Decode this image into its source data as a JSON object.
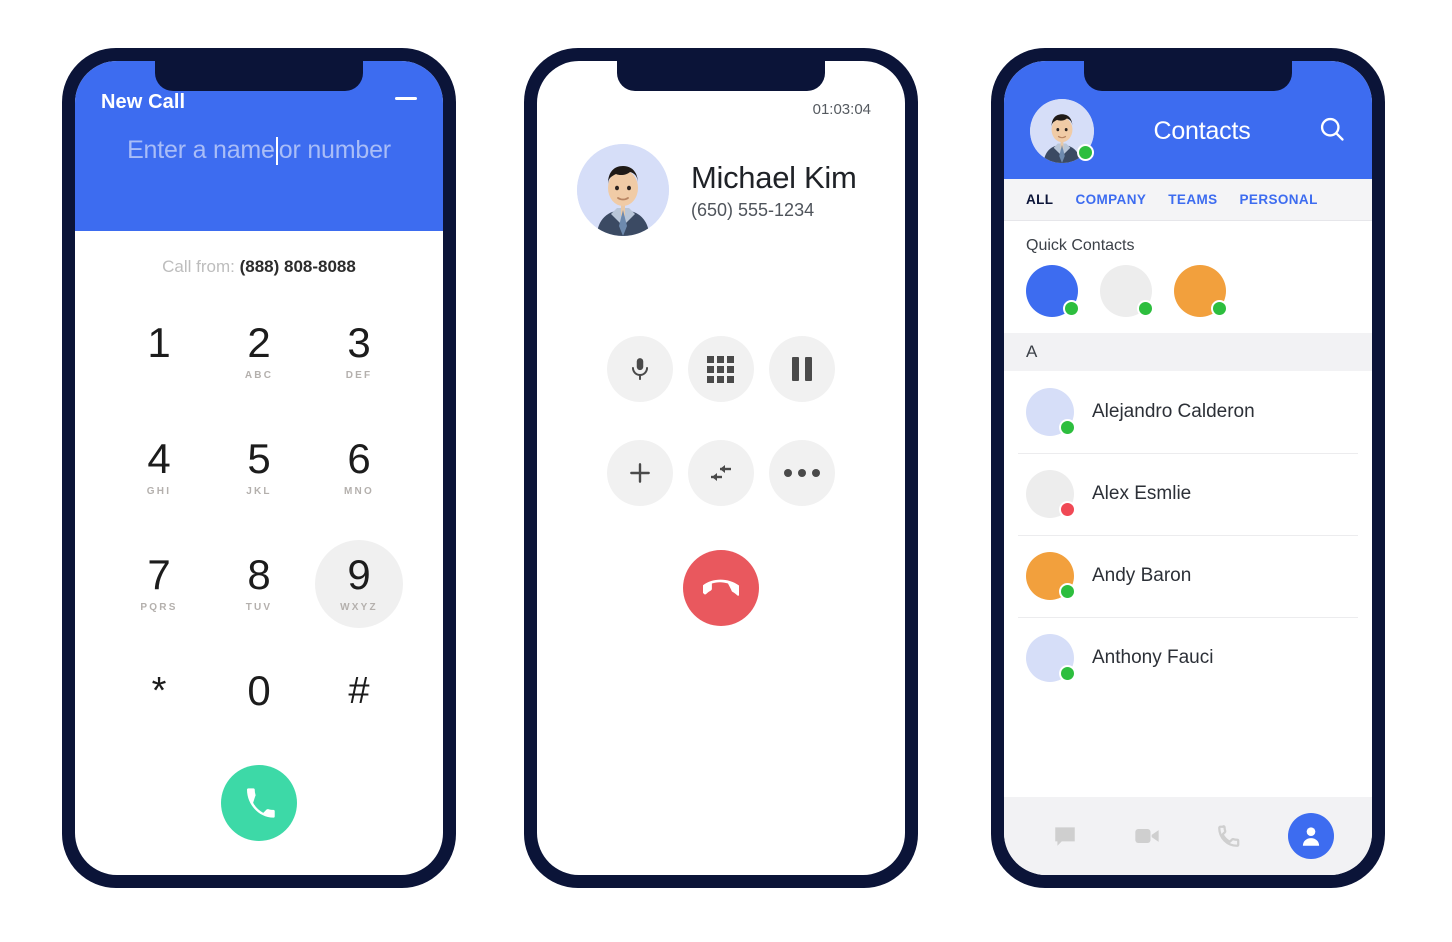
{
  "dialer": {
    "title": "New Call",
    "minimize_icon": "minimize-icon",
    "input_value_before_caret": "Enter a name",
    "input_value_after_caret": "or number",
    "input_placeholder": "Enter a name or number",
    "call_from_label": "Call from:",
    "call_from_number": "(888) 808-8088",
    "keys": [
      {
        "digit": "1",
        "letters": ""
      },
      {
        "digit": "2",
        "letters": "ABC"
      },
      {
        "digit": "3",
        "letters": "DEF"
      },
      {
        "digit": "4",
        "letters": "GHI"
      },
      {
        "digit": "5",
        "letters": "JKL"
      },
      {
        "digit": "6",
        "letters": "MNO"
      },
      {
        "digit": "7",
        "letters": "PQRS"
      },
      {
        "digit": "8",
        "letters": "TUV"
      },
      {
        "digit": "9",
        "letters": "WXYZ",
        "pressed": true
      },
      {
        "digit": "*",
        "letters": ""
      },
      {
        "digit": "0",
        "letters": ""
      },
      {
        "digit": "#",
        "letters": ""
      }
    ],
    "call_button_icon": "phone-icon",
    "colors": {
      "header": "#3D6CF0",
      "call_button": "#3DD9A7",
      "placeholder": "#A9BDF7"
    }
  },
  "active_call": {
    "timer": "01:03:04",
    "caller_name": "Michael Kim",
    "caller_number": "(650) 555-1234",
    "avatar_icon": "contact-photo",
    "controls": [
      {
        "name": "mute-button",
        "icon": "microphone-icon"
      },
      {
        "name": "keypad-button",
        "icon": "dialpad-grid-icon"
      },
      {
        "name": "hold-button",
        "icon": "pause-icon"
      },
      {
        "name": "add-call-button",
        "icon": "plus-icon"
      },
      {
        "name": "transfer-button",
        "icon": "transfer-arrows-icon"
      },
      {
        "name": "more-options-button",
        "icon": "ellipsis-icon"
      }
    ],
    "end_call_icon": "end-call-icon",
    "colors": {
      "control_bg": "#F1F1F1",
      "end_call": "#E9585E"
    }
  },
  "contacts": {
    "title": "Contacts",
    "avatar_icon": "user-photo",
    "avatar_status": "#2DBE3E",
    "search_icon": "search-icon",
    "tabs": [
      {
        "label": "ALL",
        "active": true
      },
      {
        "label": "COMPANY",
        "active": false
      },
      {
        "label": "TEAMS",
        "active": false
      },
      {
        "label": "PERSONAL",
        "active": false
      }
    ],
    "quick_contacts_title": "Quick Contacts",
    "quick_contacts": [
      {
        "name": "quick-contact-1",
        "color": "#3D6CF0",
        "status": "#2DBE3E"
      },
      {
        "name": "quick-contact-2",
        "color": "#EDEDED",
        "status": "#2DBE3E"
      },
      {
        "name": "quick-contact-3",
        "color": "#F2A03D",
        "status": "#2DBE3E"
      }
    ],
    "section_label": "A",
    "list": [
      {
        "name": "Alejandro Calderon",
        "color": "#D6DEF8",
        "status": "#2DBE3E"
      },
      {
        "name": "Alex Esmlie",
        "color": "#EDEDED",
        "status": "#F04955"
      },
      {
        "name": "Andy Baron",
        "color": "#F2A03D",
        "status": "#2DBE3E"
      },
      {
        "name": "Anthony Fauci",
        "color": "#D6DEF8",
        "status": "#2DBE3E"
      }
    ],
    "bottom_nav": [
      {
        "name": "nav-messages",
        "icon": "chat-bubble-icon",
        "active": false
      },
      {
        "name": "nav-video",
        "icon": "video-camera-icon",
        "active": false
      },
      {
        "name": "nav-calls",
        "icon": "phone-icon",
        "active": false
      },
      {
        "name": "nav-contacts",
        "icon": "person-icon",
        "active": true
      }
    ],
    "colors": {
      "header": "#3D6CF0",
      "tab_active": "#0B1438",
      "tab_inactive": "#3D6CF0"
    }
  }
}
